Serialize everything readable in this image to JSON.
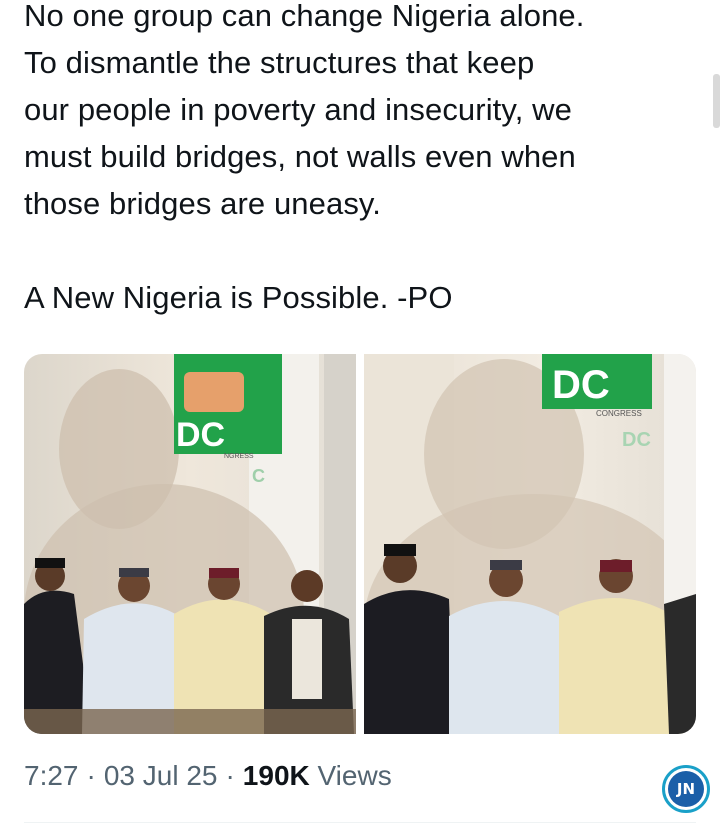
{
  "tweet": {
    "lines": [
      "No one group can change Nigeria alone.",
      "To dismantle the structures that keep",
      "our people in poverty and insecurity, we",
      "must build bridges, not walls even when",
      "those bridges are uneasy."
    ],
    "closing": "A New Nigeria is Possible. -PO"
  },
  "media": {
    "photo1": {
      "sign_text": "DC",
      "sign_small": "NGRESS",
      "sign_tail": "C"
    },
    "photo2": {
      "sign_text": "DC",
      "sign_small": "CONGRESS",
      "sign_tail": "DC"
    }
  },
  "meta": {
    "time": "7:27",
    "sep1": "·",
    "date": "03 Jul 25",
    "sep2": "·",
    "views_count": "190K",
    "views_label": "Views"
  },
  "badge": {
    "label": "JN"
  },
  "colors": {
    "accent_green": "#22a24a",
    "text_muted": "#536471",
    "badge_ring": "#1aa0c8"
  }
}
